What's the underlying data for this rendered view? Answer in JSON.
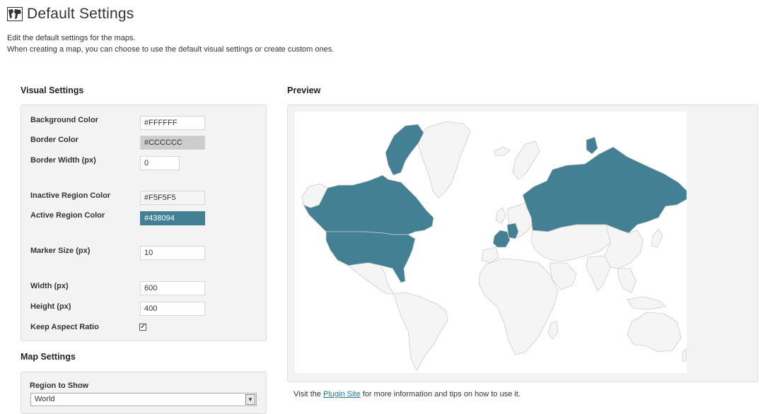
{
  "page": {
    "title": "Default Settings",
    "title_icon": "globe-map-icon",
    "intro_line1": "Edit the default settings for the maps.",
    "intro_line2": "When creating a map, you can choose to use the default visual settings or create custom ones."
  },
  "visual_settings": {
    "heading": "Visual Settings",
    "background_color": {
      "label": "Background Color",
      "value": "#FFFFFF"
    },
    "border_color": {
      "label": "Border Color",
      "value": "#CCCCCC"
    },
    "border_width": {
      "label": "Border Width (px)",
      "value": "0"
    },
    "inactive_region_color": {
      "label": "Inactive Region Color",
      "value": "#F5F5F5"
    },
    "active_region_color": {
      "label": "Active Region Color",
      "value": "#438094"
    },
    "marker_size": {
      "label": "Marker Size (px)",
      "value": "10"
    },
    "width": {
      "label": "Width (px)",
      "value": "600"
    },
    "height": {
      "label": "Height (px)",
      "value": "400"
    },
    "keep_aspect_ratio": {
      "label": "Keep Aspect Ratio",
      "checked": true,
      "check_glyph": "✓"
    }
  },
  "map_settings": {
    "heading": "Map Settings",
    "region_to_show": {
      "label": "Region to Show",
      "value": "World"
    }
  },
  "preview": {
    "heading": "Preview",
    "active_regions": [
      "Canada",
      "United States",
      "Greenland-adjacent islands",
      "France",
      "Germany",
      "Russia"
    ],
    "colors": {
      "active": "#438094",
      "inactive": "#f5f5f5",
      "border": "#cccccc"
    }
  },
  "footer": {
    "prefix": "Visit the ",
    "link_text": "Plugin Site",
    "suffix": " for more information and tips on how to use it."
  }
}
